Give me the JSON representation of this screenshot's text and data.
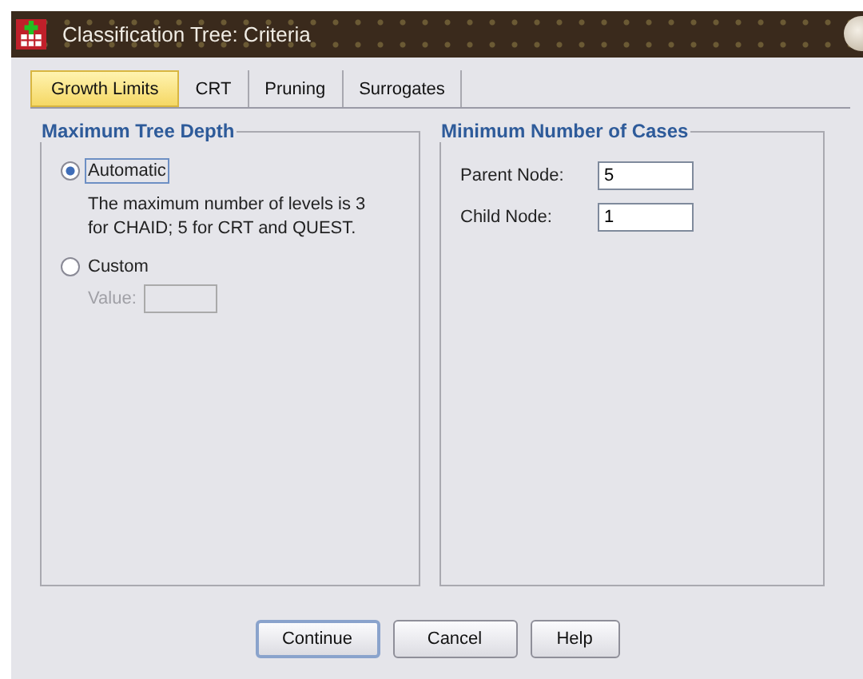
{
  "window": {
    "title": "Classification Tree: Criteria"
  },
  "tabs": [
    {
      "label": "Growth Limits",
      "selected": true
    },
    {
      "label": "CRT",
      "selected": false
    },
    {
      "label": "Pruning",
      "selected": false
    },
    {
      "label": "Surrogates",
      "selected": false
    }
  ],
  "max_depth": {
    "title": "Maximum Tree Depth",
    "options": [
      {
        "label": "Automatic",
        "selected": true,
        "focused": true,
        "note": "The maximum number of levels is 3 for CHAID; 5 for CRT and QUEST."
      },
      {
        "label": "Custom",
        "selected": false,
        "focused": false
      }
    ],
    "value_field": {
      "label": "Value:",
      "disabled": true
    }
  },
  "min_cases": {
    "title": "Minimum Number of Cases",
    "fields": [
      {
        "label": "Parent Node:",
        "value": "5"
      },
      {
        "label": "Child Node:",
        "value": "1"
      }
    ]
  },
  "buttons": [
    {
      "label": "Continue",
      "default": true
    },
    {
      "label": "Cancel",
      "default": false
    },
    {
      "label": "Help",
      "default": false
    }
  ]
}
